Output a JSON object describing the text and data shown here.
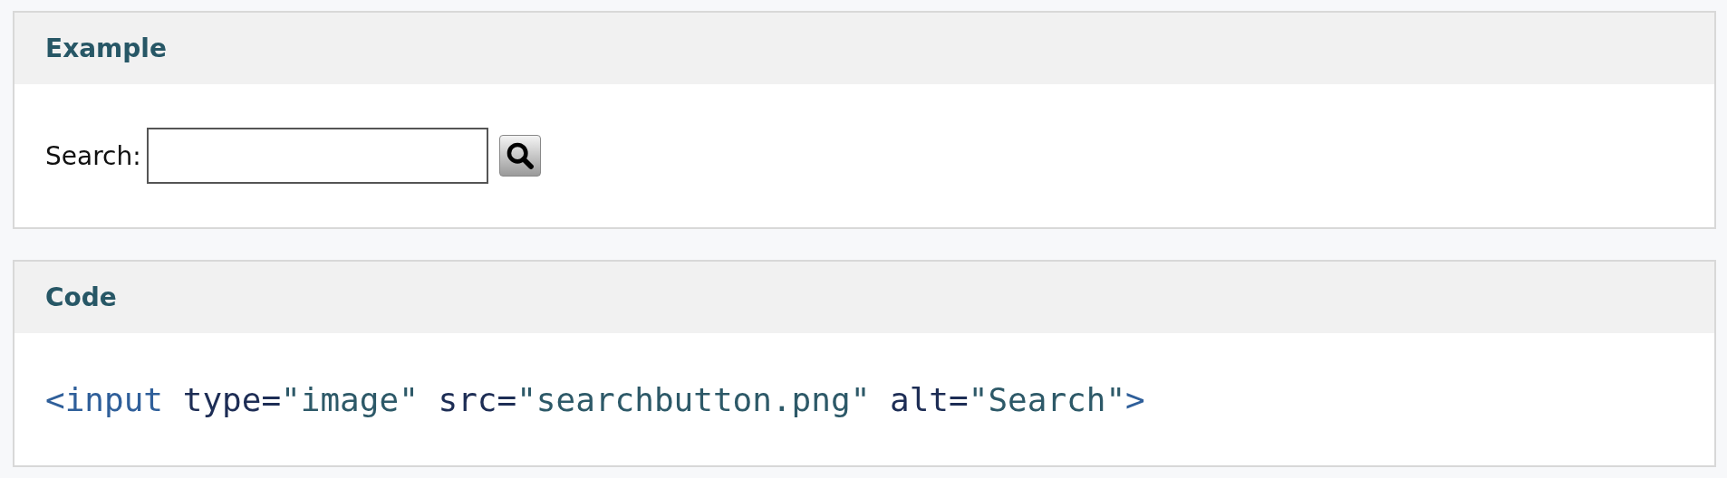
{
  "example": {
    "title": "Example",
    "search": {
      "label": "Search:"
    }
  },
  "code": {
    "title": "Code",
    "tokens": [
      {
        "kind": "tag",
        "text": "<input"
      },
      {
        "kind": "attr",
        "text": " type="
      },
      {
        "kind": "value",
        "text": "\"image\""
      },
      {
        "kind": "attr",
        "text": " src="
      },
      {
        "kind": "value",
        "text": "\"searchbutton.png\""
      },
      {
        "kind": "attr",
        "text": " alt="
      },
      {
        "kind": "value",
        "text": "\"Search\""
      },
      {
        "kind": "tag",
        "text": ">"
      }
    ]
  }
}
